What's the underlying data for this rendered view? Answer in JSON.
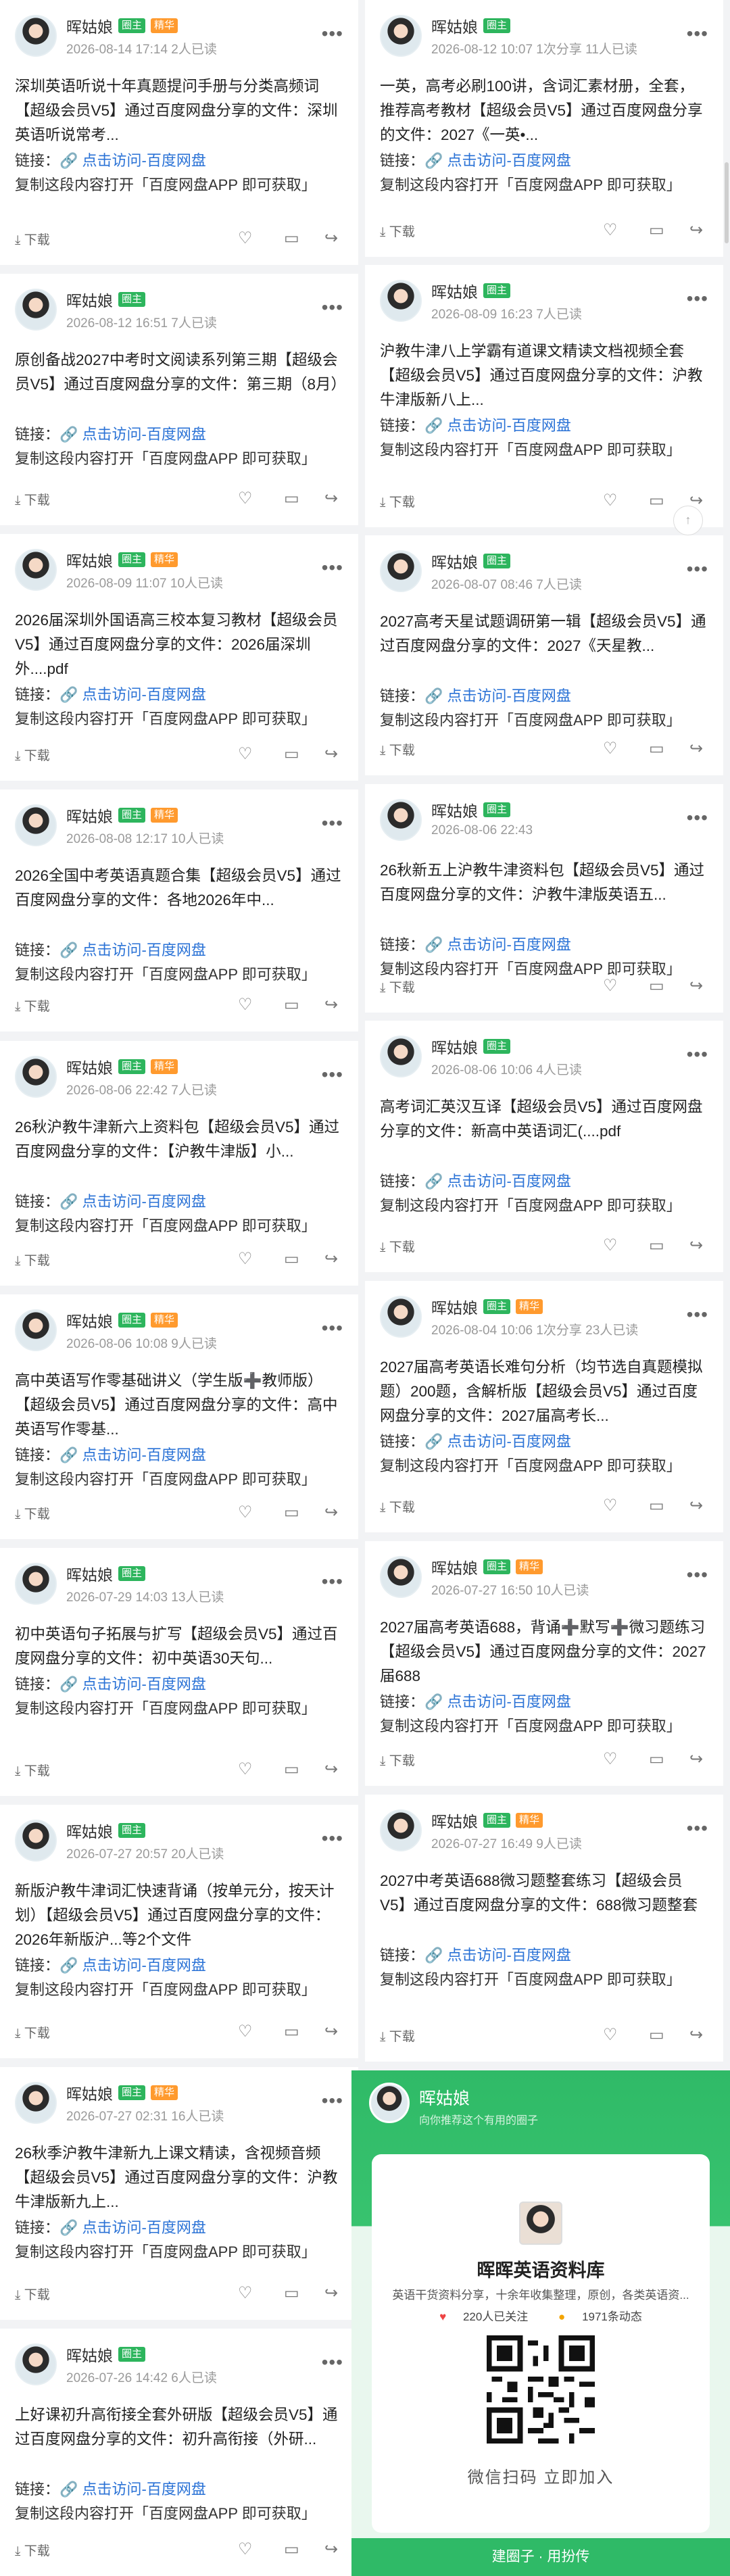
{
  "common": {
    "link_label": "链接：",
    "link_text": "🔗 点击访问-百度网盘",
    "copy_text": "复制这段内容打开「百度网盘APP 即可获取」",
    "download_label": "下载",
    "more": "•••",
    "badge_owner": "圈主",
    "badge_essence": "精华"
  },
  "posts_left": [
    {
      "user": "晖姑娘",
      "essence": true,
      "meta": "2026-08-14 17:14 2人已读",
      "body": "深圳英语听说十年真题提问手册与分类高频词【超级会员V5】通过百度网盘分享的文件：深圳英语听说常考..."
    },
    {
      "user": "晖姑娘",
      "essence": false,
      "meta": "2026-08-12 16:51 7人已读",
      "body": "原创备战2027中考时文阅读系列第三期【超级会员V5】通过百度网盘分享的文件：第三期（8月）"
    },
    {
      "user": "晖姑娘",
      "essence": true,
      "meta": "2026-08-09 11:07 10人已读",
      "body": "2026届深圳外国语高三校本复习教材【超级会员V5】通过百度网盘分享的文件：2026届深圳外....pdf"
    },
    {
      "user": "晖姑娘",
      "essence": true,
      "meta": "2026-08-08 12:17 10人已读",
      "body": "2026全国中考英语真题合集【超级会员V5】通过百度网盘分享的文件：各地2026年中..."
    },
    {
      "user": "晖姑娘",
      "essence": true,
      "meta": "2026-08-06 22:42 7人已读",
      "body": "26秋沪教牛津新六上资料包【超级会员V5】通过百度网盘分享的文件：【沪教牛津版】小..."
    },
    {
      "user": "晖姑娘",
      "essence": true,
      "meta": "2026-08-06 10:08 9人已读",
      "body": "高中英语写作零基础讲义（学生版➕教师版）【超级会员V5】通过百度网盘分享的文件：高中英语写作零基..."
    },
    {
      "user": "晖姑娘",
      "essence": false,
      "meta": "2026-07-29 14:03 13人已读",
      "body": "初中英语句子拓展与扩写【超级会员V5】通过百度网盘分享的文件：初中英语30天句..."
    },
    {
      "user": "晖姑娘",
      "essence": false,
      "meta": "2026-07-27 20:57 20人已读",
      "body": "新版沪教牛津词汇快速背诵（按单元分，按天计划）【超级会员V5】通过百度网盘分享的文件：2026年新版沪...等2个文件"
    },
    {
      "user": "晖姑娘",
      "essence": true,
      "meta": "2026-07-27 02:31 16人已读",
      "body": "26秋季沪教牛津新九上课文精读，含视频音频【超级会员V5】通过百度网盘分享的文件：沪教牛津版新九上..."
    },
    {
      "user": "晖姑娘",
      "essence": false,
      "meta": "2026-07-26 14:42 6人已读",
      "body": "上好课初升高衔接全套外研版【超级会员V5】通过百度网盘分享的文件：初升高衔接（外研..."
    }
  ],
  "posts_right": [
    {
      "user": "晖姑娘",
      "essence": false,
      "meta": "2026-08-12 10:07 1次分享 11人已读",
      "body": "一英，高考必刷100讲，含词汇素材册，全套，推荐高考教材【超级会员V5】通过百度网盘分享的文件：2027《一英•..."
    },
    {
      "user": "晖姑娘",
      "essence": false,
      "meta": "2026-08-09 16:23 7人已读",
      "body": "沪教牛津八上学霸有道课文精读文档视频全套【超级会员V5】通过百度网盘分享的文件：沪教牛津版新八上..."
    },
    {
      "user": "晖姑娘",
      "essence": false,
      "meta": "2026-08-07 08:46 7人已读",
      "body": "2027高考天星试题调研第一辑【超级会员V5】通过百度网盘分享的文件：2027《天星教..."
    },
    {
      "user": "晖姑娘",
      "essence": false,
      "meta": "2026-08-06 22:43",
      "body": "26秋新五上沪教牛津资料包【超级会员V5】通过百度网盘分享的文件：沪教牛津版英语五..."
    },
    {
      "user": "晖姑娘",
      "essence": false,
      "meta": "2026-08-06 10:06 4人已读",
      "body": "高考词汇英汉互译【超级会员V5】通过百度网盘分享的文件：新高中英语词汇(....pdf"
    },
    {
      "user": "晖姑娘",
      "essence": true,
      "meta": "2026-08-04 10:06 1次分享 23人已读",
      "body": "2027届高考英语长难句分析（均节选自真题模拟题）200题，含解析版【超级会员V5】通过百度网盘分享的文件：2027届高考长..."
    },
    {
      "user": "晖姑娘",
      "essence": true,
      "meta": "2026-07-27 16:50 10人已读",
      "body": "2027届高考英语688，背诵➕默写➕微习题练习【超级会员V5】通过百度网盘分享的文件：2027届688"
    },
    {
      "user": "晖姑娘",
      "essence": true,
      "meta": "2026-07-27 16:49 9人已读",
      "body": "2027中考英语688微习题整套练习【超级会员V5】通过百度网盘分享的文件：688微习题整套"
    }
  ],
  "promo": {
    "name": "晖姑娘",
    "subtitle": "向你推荐这个有用的圈子",
    "group_name": "晖晖英语资料库",
    "group_desc": "英语干货资料分享，十余年收集整理，原创，各类英语资...",
    "members": "220人已关注",
    "updates": "1971条动态",
    "scan_text": "微信扫码 立即加入",
    "footer": "建圈子 · 用扮传"
  },
  "top_button": "↑"
}
